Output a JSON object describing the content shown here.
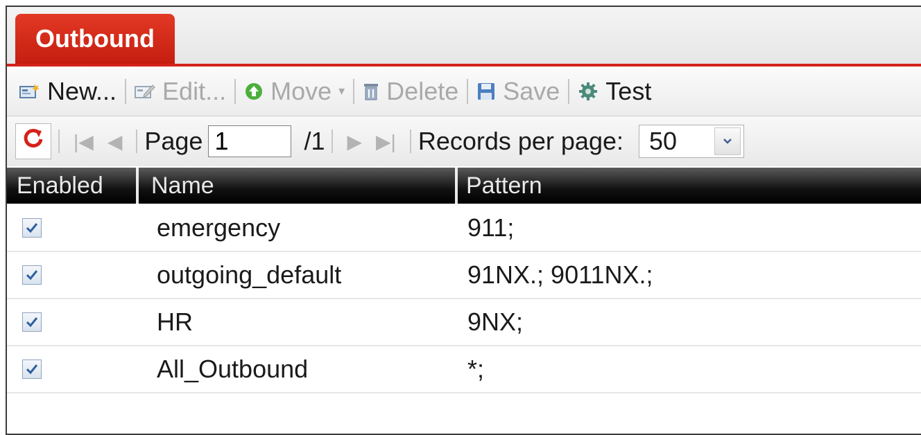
{
  "tab": {
    "label": "Outbound"
  },
  "toolbar": {
    "new_label": "New...",
    "edit_label": "Edit...",
    "move_label": "Move",
    "delete_label": "Delete",
    "save_label": "Save",
    "test_label": "Test"
  },
  "pager": {
    "page_label": "Page",
    "page_value": "1",
    "total_pages": "/1",
    "records_label": "Records per page:",
    "records_value": "50"
  },
  "grid": {
    "headers": [
      "Enabled",
      "Name",
      "Pattern"
    ],
    "rows": [
      {
        "enabled": true,
        "name": "emergency",
        "pattern": "911;"
      },
      {
        "enabled": true,
        "name": "outgoing_default",
        "pattern": "91NX.; 9011NX.;"
      },
      {
        "enabled": true,
        "name": "HR",
        "pattern": "9NX;"
      },
      {
        "enabled": true,
        "name": "All_Outbound",
        "pattern": "*;"
      }
    ]
  },
  "colors": {
    "accent": "#d4221a",
    "header_bg": "#111111"
  }
}
